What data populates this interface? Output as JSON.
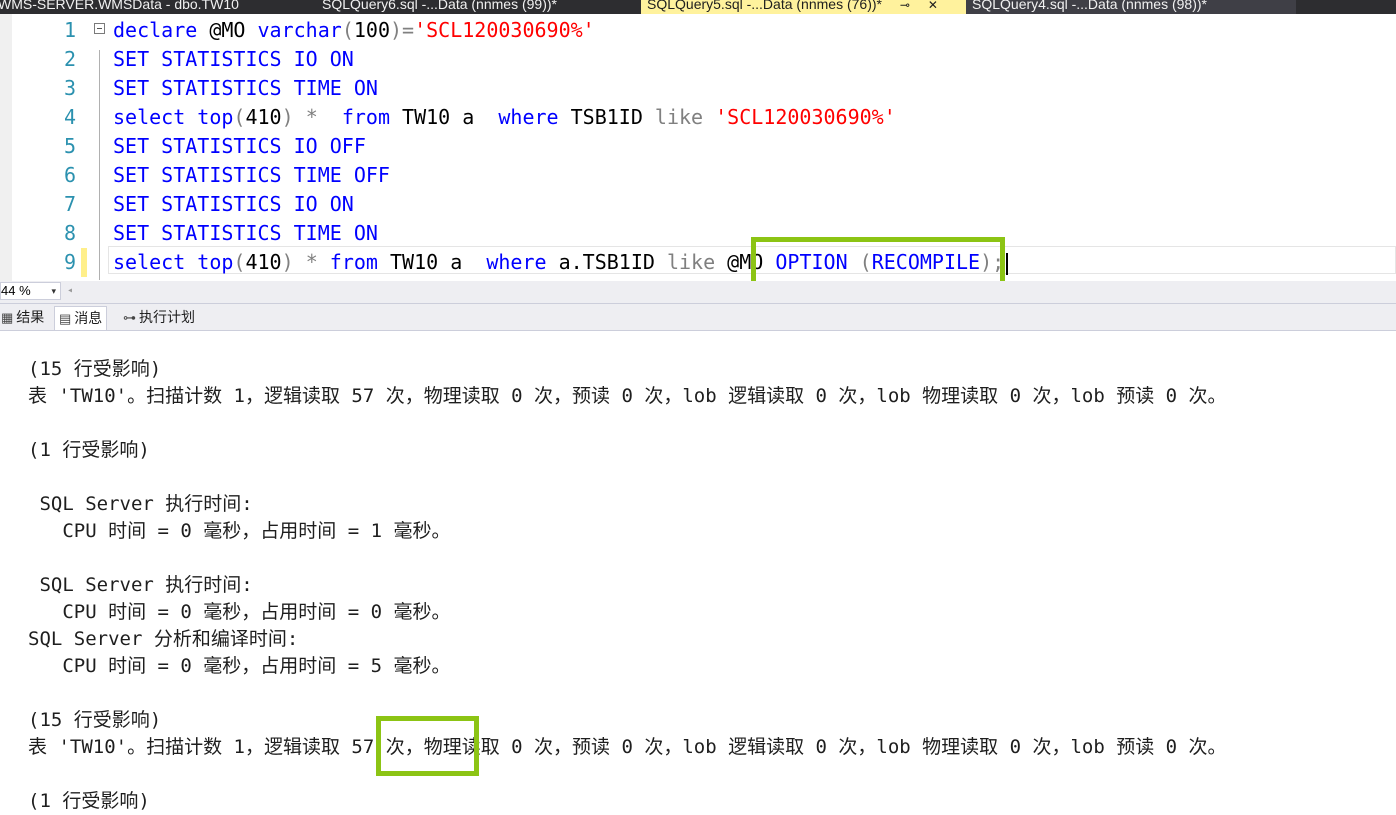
{
  "tabs": [
    {
      "label": "WMS-SERVER.WMSData - dbo.TW10"
    },
    {
      "label": "SQLQuery6.sql -...Data (nnmes (99))*"
    },
    {
      "label": "SQLQuery5.sql -...Data (nnmes (76))*",
      "pin": "⊸",
      "close": "✕"
    },
    {
      "label": "SQLQuery4.sql -...Data (nnmes (98))*"
    }
  ],
  "editor": {
    "line_numbers": [
      "1",
      "2",
      "3",
      "4",
      "5",
      "6",
      "7",
      "8",
      "9"
    ],
    "lines": [
      [
        {
          "t": "declare",
          "c": "kw"
        },
        {
          "t": " @MO "
        },
        {
          "t": "varchar",
          "c": "kw"
        },
        {
          "t": "(",
          "c": "op"
        },
        {
          "t": "100"
        },
        {
          "t": ")=",
          "c": "op"
        },
        {
          "t": "'SCL120030690%'",
          "c": "str"
        }
      ],
      [
        {
          "t": "SET STATISTICS IO ON",
          "c": "kw"
        }
      ],
      [
        {
          "t": "SET STATISTICS TIME ON",
          "c": "kw"
        }
      ],
      [
        {
          "t": "select",
          "c": "kw"
        },
        {
          "t": " "
        },
        {
          "t": "top",
          "c": "kw"
        },
        {
          "t": "(",
          "c": "op"
        },
        {
          "t": "410"
        },
        {
          "t": ")",
          "c": "op"
        },
        {
          "t": " "
        },
        {
          "t": "*",
          "c": "op"
        },
        {
          "t": "  "
        },
        {
          "t": "from",
          "c": "kw"
        },
        {
          "t": " TW10 a  "
        },
        {
          "t": "where",
          "c": "kw"
        },
        {
          "t": " TSB1ID "
        },
        {
          "t": "like",
          "c": "op"
        },
        {
          "t": " "
        },
        {
          "t": "'SCL120030690%'",
          "c": "str"
        }
      ],
      [
        {
          "t": "SET STATISTICS IO OFF",
          "c": "kw"
        }
      ],
      [
        {
          "t": "SET STATISTICS TIME OFF",
          "c": "kw"
        }
      ],
      [
        {
          "t": "SET STATISTICS IO ON",
          "c": "kw"
        }
      ],
      [
        {
          "t": "SET STATISTICS TIME ON",
          "c": "kw"
        }
      ],
      [
        {
          "t": "select",
          "c": "kw"
        },
        {
          "t": " "
        },
        {
          "t": "top",
          "c": "kw"
        },
        {
          "t": "(",
          "c": "op"
        },
        {
          "t": "410"
        },
        {
          "t": ")",
          "c": "op"
        },
        {
          "t": " "
        },
        {
          "t": "*",
          "c": "op"
        },
        {
          "t": " "
        },
        {
          "t": "from",
          "c": "kw"
        },
        {
          "t": " TW10 a  "
        },
        {
          "t": "where",
          "c": "kw"
        },
        {
          "t": " a.TSB1ID "
        },
        {
          "t": "like",
          "c": "op"
        },
        {
          "t": " @MO "
        },
        {
          "t": "OPTION",
          "c": "kw"
        },
        {
          "t": " "
        },
        {
          "t": "(",
          "c": "op"
        },
        {
          "t": "RECOMPILE",
          "c": "kw"
        },
        {
          "t": ");",
          "c": "op"
        }
      ]
    ]
  },
  "zoom": {
    "value": "44 %",
    "arrow": "▾",
    "scroll_left": "◂"
  },
  "result_tabs": [
    {
      "label": "结果",
      "icon": "▦"
    },
    {
      "label": "消息",
      "icon": "▤"
    },
    {
      "label": "执行计划",
      "icon": "⊶"
    }
  ],
  "messages": [
    "(15 行受影响)",
    "表 'TW10'。扫描计数 1，逻辑读取 57 次，物理读取 0 次，预读 0 次，lob 逻辑读取 0 次，lob 物理读取 0 次，lob 预读 0 次。",
    "(1 行受影响)",
    " SQL Server 执行时间:",
    "   CPU 时间 = 0 毫秒，占用时间 = 1 毫秒。",
    " SQL Server 执行时间:",
    "   CPU 时间 = 0 毫秒，占用时间 = 0 毫秒。",
    "SQL Server 分析和编译时间:",
    "   CPU 时间 = 0 毫秒，占用时间 = 5 毫秒。",
    "(15 行受影响)",
    "表 'TW10'。扫描计数 1，逻辑读取 57 次，物理读取 0 次，预读 0 次，lob 逻辑读取 0 次，lob 物理读取 0 次，lob 预读 0 次。",
    "(1 行受影响)"
  ],
  "colors": {
    "highlight": "#8cc414",
    "keyword": "#0000ff",
    "string": "#ff0000",
    "line_number": "#2b91af"
  }
}
